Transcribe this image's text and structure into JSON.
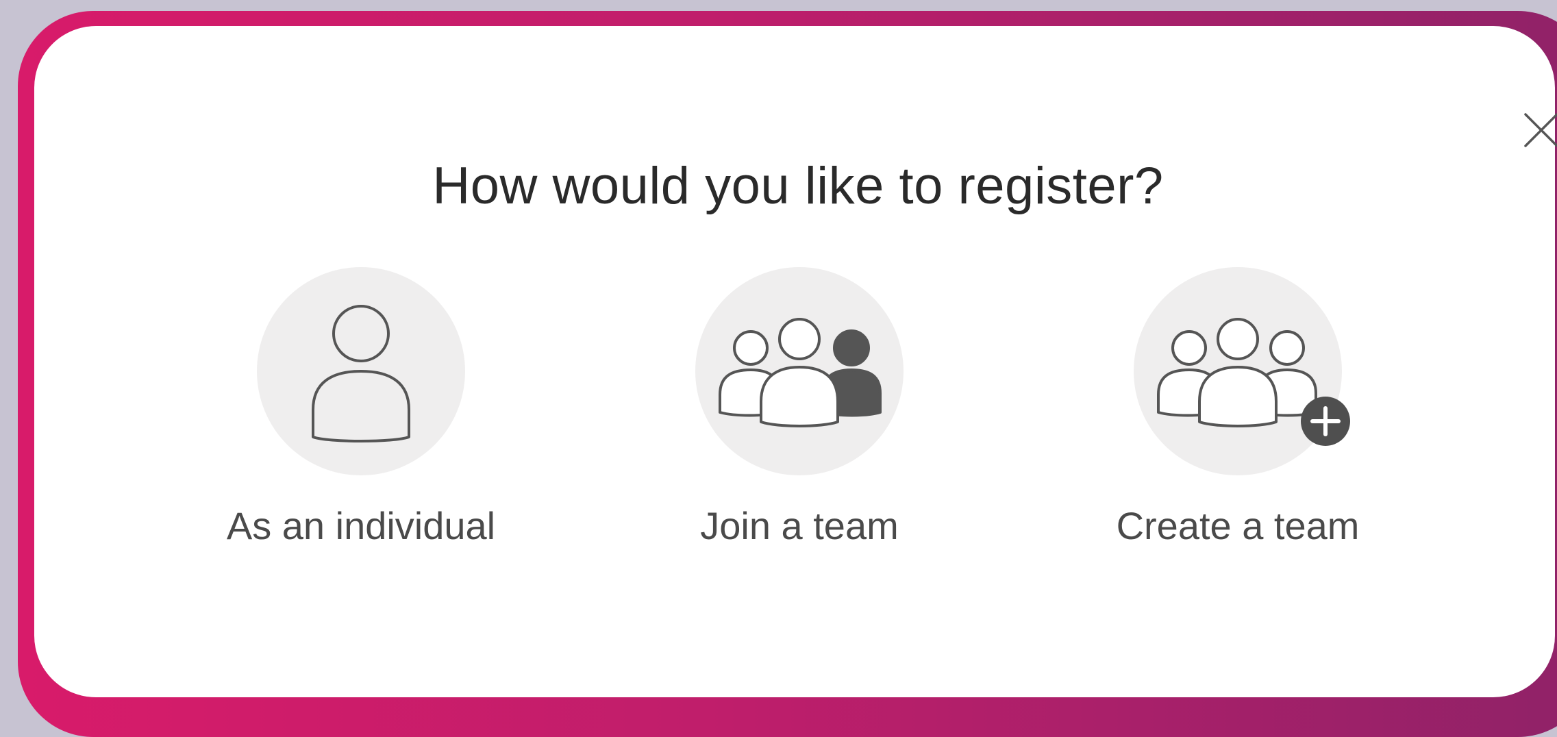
{
  "dialog": {
    "title": "How would you like to register?",
    "close_icon": "close-icon",
    "options": [
      {
        "label": "As an individual",
        "icon": "person-icon"
      },
      {
        "label": "Join a team",
        "icon": "join-team-icon"
      },
      {
        "label": "Create a team",
        "icon": "create-team-icon"
      }
    ]
  },
  "colors": {
    "background": "#c7c3d2",
    "frame_gradient_start": "#d81b6a",
    "frame_gradient_end": "#8f2268",
    "dialog_background": "#ffffff",
    "icon_circle": "#efeeee",
    "icon_stroke": "#555555",
    "title_text": "#2a2a2a",
    "label_text": "#4a4a4a"
  }
}
